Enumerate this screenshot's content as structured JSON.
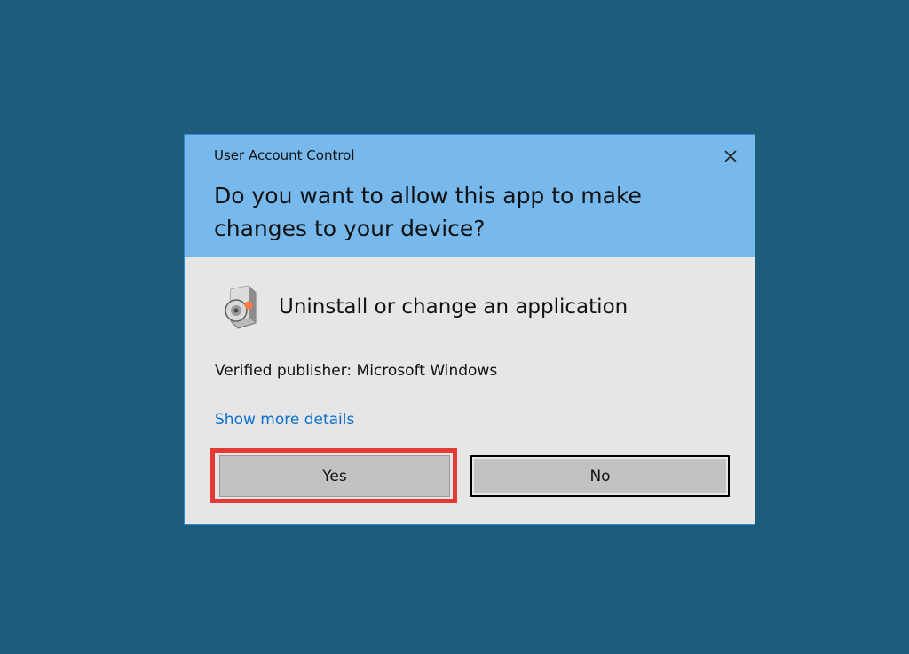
{
  "dialog": {
    "window_title": "User Account Control",
    "question": "Do you want to allow this app to make changes to your device?",
    "app_name": "Uninstall or change an application",
    "publisher": "Verified publisher: Microsoft Windows",
    "details_link": "Show more details",
    "yes_label": "Yes",
    "no_label": "No",
    "close_icon": "close-icon",
    "app_icon": "program-installer-icon"
  },
  "colors": {
    "desktop_background": "#1d5c7a",
    "header_background": "#77b9ed",
    "body_background": "#e6e6e6",
    "link": "#0a70cc",
    "highlight": "#e53935"
  }
}
